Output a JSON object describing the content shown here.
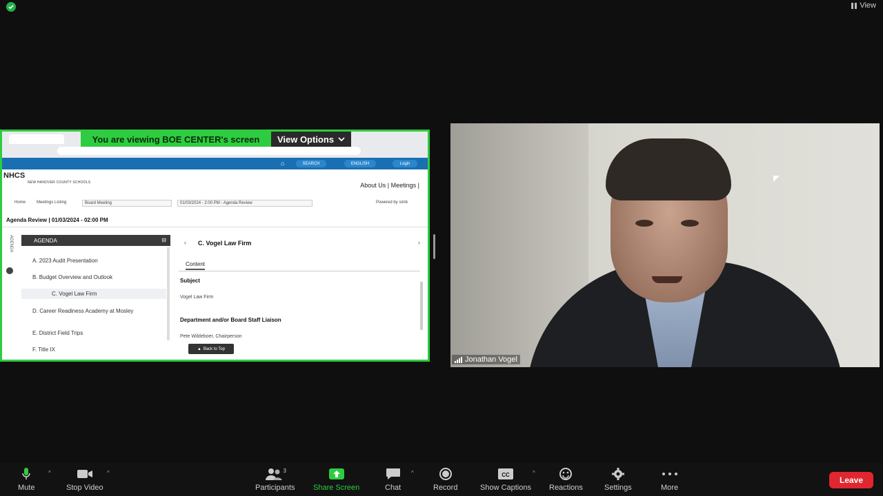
{
  "top_bar": {
    "view_label": "View"
  },
  "share": {
    "banner_text": "You are viewing  BOE CENTER's screen",
    "view_options_label": "View Options",
    "site": {
      "search_label": "SEARCH",
      "english_label": "ENGLISH",
      "login_label": "Login",
      "logo": "NHCS",
      "district_name": "NEW HANOVER COUNTY SCHOOLS",
      "about_links": "About Us | Meetings |",
      "crumbs": {
        "home": "Home",
        "meetings_listing": "Meetings Listing",
        "meeting_type": "Board Meeting",
        "meeting_date": "01/03/2024 - 2:00 PM - Agenda Review",
        "powered_by": "Powered by simb"
      },
      "agenda_review_title": "Agenda Review | 01/03/2024 - 02:00 PM",
      "side_label": "AGENDA",
      "agenda": {
        "header": "AGENDA",
        "items": [
          "A. 2023 Audit Presentation",
          "B. Budget Overview and Outlook",
          "C. Vogel Law Firm",
          "D. Career Readiness Academy at Mosley",
          "E. District Field Trips",
          "F. Title IX"
        ]
      },
      "content": {
        "title": "C. Vogel Law Firm",
        "tab": "Content",
        "subject_label": "Subject",
        "subject_value": "Vogel Law Firm",
        "dept_label": "Department and/or Board Staff Liaison",
        "dept_value": "Pete Wildeboer, Chairperson",
        "back_to_top": "Back to Top"
      }
    }
  },
  "video": {
    "participant_name": "Jonathan Vogel"
  },
  "toolbar": {
    "mute": "Mute",
    "stop_video": "Stop Video",
    "participants": "Participants",
    "participants_count": "3",
    "share_screen": "Share Screen",
    "chat": "Chat",
    "record": "Record",
    "show_captions": "Show Captions",
    "reactions": "Reactions",
    "settings": "Settings",
    "more": "More",
    "leave": "Leave"
  },
  "colors": {
    "accent_green": "#2ecc40",
    "leave_red": "#e0262f",
    "site_blue": "#1a6fb3"
  }
}
